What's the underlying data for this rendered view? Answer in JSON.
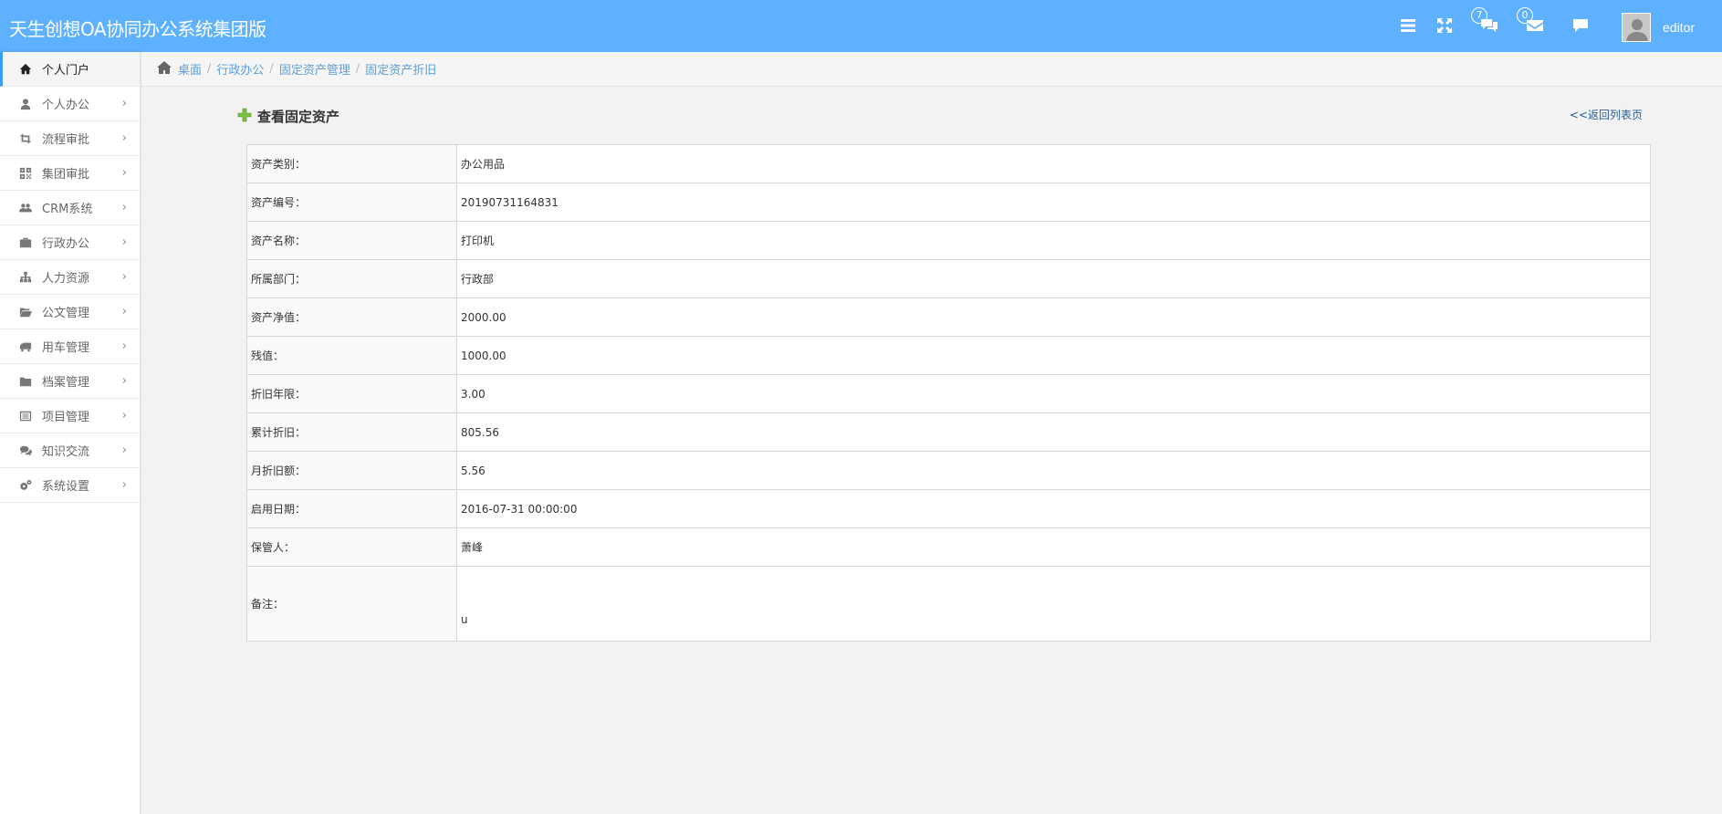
{
  "app": {
    "title": "天生创想OA协同办公系统集团版"
  },
  "topbar": {
    "icons": {
      "menu": "menu-icon",
      "fullscreen": "fullscreen-icon",
      "chat": "chat-icon",
      "mail": "mail-icon",
      "message": "message-icon"
    },
    "chat_badge": "7",
    "mail_badge": "0",
    "username": "editor"
  },
  "sidebar": {
    "items": [
      {
        "label": "个人门户",
        "icon": "home-icon",
        "active": true
      },
      {
        "label": "个人办公",
        "icon": "user-icon"
      },
      {
        "label": "流程审批",
        "icon": "retweet-icon"
      },
      {
        "label": "集团审批",
        "icon": "qrcode-icon"
      },
      {
        "label": "CRM系统",
        "icon": "group-icon"
      },
      {
        "label": "行政办公",
        "icon": "briefcase-icon"
      },
      {
        "label": "人力资源",
        "icon": "sitemap-icon"
      },
      {
        "label": "公文管理",
        "icon": "folder-open-icon"
      },
      {
        "label": "用车管理",
        "icon": "truck-icon"
      },
      {
        "label": "档案管理",
        "icon": "folder-icon"
      },
      {
        "label": "项目管理",
        "icon": "list-alt-icon"
      },
      {
        "label": "知识交流",
        "icon": "comments-icon"
      },
      {
        "label": "系统设置",
        "icon": "cogs-icon"
      }
    ],
    "chevron": "›"
  },
  "breadcrumb": {
    "items": [
      "桌面",
      "行政办公",
      "固定资产管理",
      "固定资产折旧"
    ],
    "separator": "/"
  },
  "panel": {
    "title": "查看固定资产",
    "back_link": "<<返回列表页"
  },
  "details": {
    "rows": [
      {
        "label": "资产类别：",
        "value": "办公用品"
      },
      {
        "label": "资产编号：",
        "value": "20190731164831"
      },
      {
        "label": "资产名称：",
        "value": "打印机"
      },
      {
        "label": "所属部门：",
        "value": "行政部"
      },
      {
        "label": "资产净值：",
        "value": "2000.00"
      },
      {
        "label": "残值：",
        "value": "1000.00"
      },
      {
        "label": "折旧年限：",
        "value": "3.00"
      },
      {
        "label": "累计折旧：",
        "value": "805.56"
      },
      {
        "label": "月折旧额：",
        "value": "5.56"
      },
      {
        "label": "启用日期：",
        "value": "2016-07-31 00:00:00"
      },
      {
        "label": "保管人：",
        "value": "萧峰"
      },
      {
        "label": "备注：",
        "value": "u"
      }
    ]
  },
  "colors": {
    "header_bg": "#5eb1ff",
    "link": "#5e9fd8",
    "active_accent": "#3a9bff"
  }
}
